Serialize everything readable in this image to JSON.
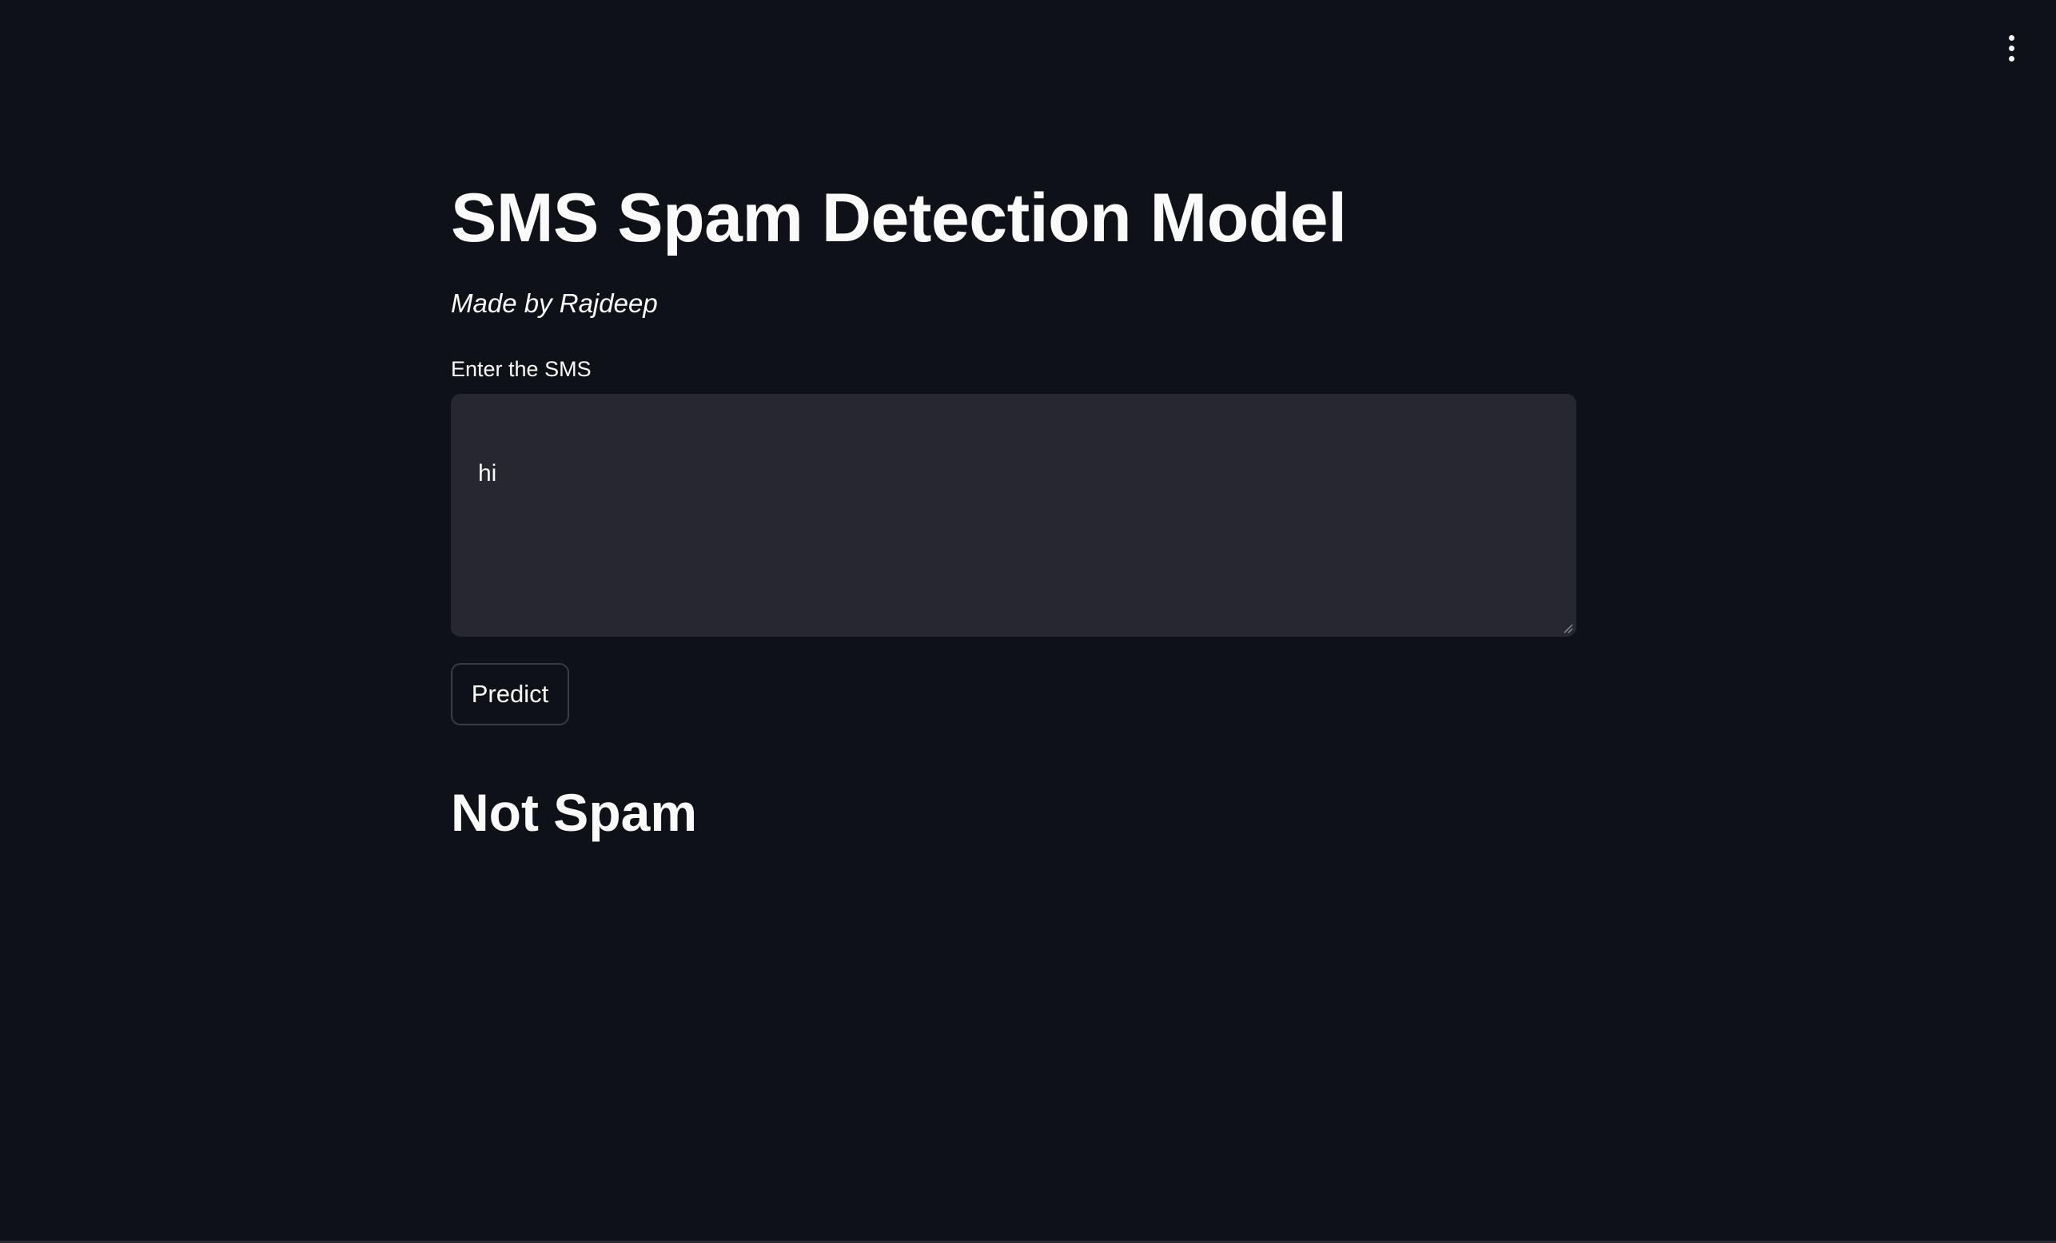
{
  "header": {
    "menu_icon": "vertical-ellipsis-icon"
  },
  "main": {
    "title": "SMS Spam Detection Model",
    "subtitle": "Made by Rajdeep",
    "input_label": "Enter the SMS",
    "input_value": "hi",
    "predict_button_label": "Predict",
    "result": "Not Spam"
  },
  "colors": {
    "background": "#0e1117",
    "input_background": "#262730",
    "text": "#fafafa",
    "button_border": "#3a3b44"
  }
}
